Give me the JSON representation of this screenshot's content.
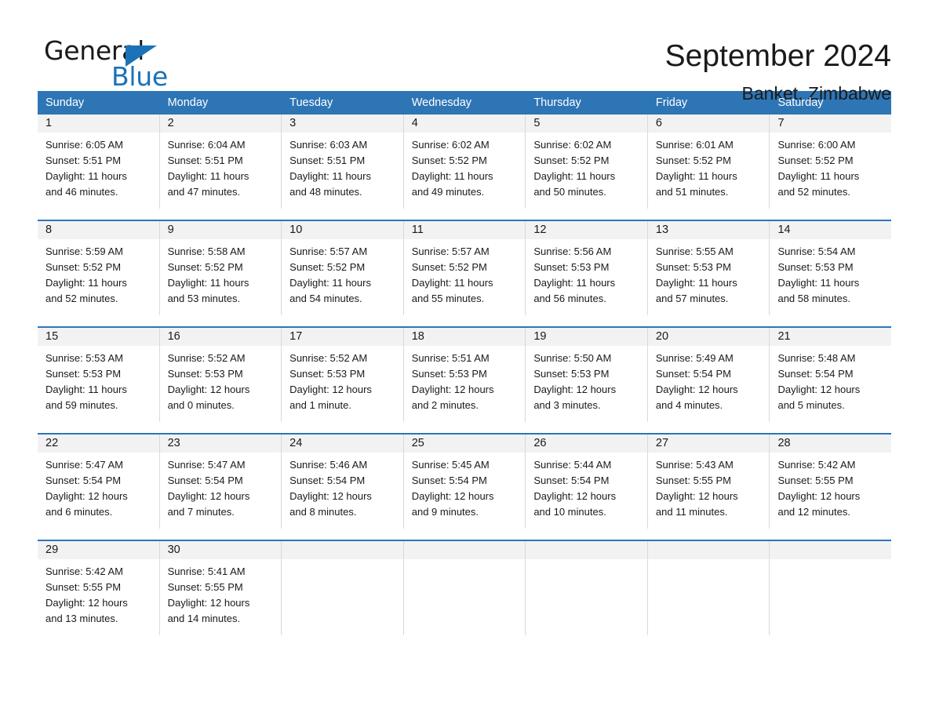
{
  "brand": {
    "word1": "General",
    "word2": "Blue",
    "triangle_color": "#1B72B8"
  },
  "header": {
    "month_title": "September 2024",
    "location": "Banket, Zimbabwe",
    "header_bg": "#2E75B6",
    "daynum_bg": "#F2F2F2"
  },
  "calendar": {
    "weekday_headers": [
      "Sunday",
      "Monday",
      "Tuesday",
      "Wednesday",
      "Thursday",
      "Friday",
      "Saturday"
    ],
    "labels": {
      "sunrise": "Sunrise:",
      "sunset": "Sunset:",
      "daylight": "Daylight:"
    },
    "weeks": [
      [
        {
          "day": "1",
          "sunrise": "Sunrise: 6:05 AM",
          "sunset": "Sunset: 5:51 PM",
          "daylight_line1": "Daylight: 11 hours",
          "daylight_line2": "and 46 minutes."
        },
        {
          "day": "2",
          "sunrise": "Sunrise: 6:04 AM",
          "sunset": "Sunset: 5:51 PM",
          "daylight_line1": "Daylight: 11 hours",
          "daylight_line2": "and 47 minutes."
        },
        {
          "day": "3",
          "sunrise": "Sunrise: 6:03 AM",
          "sunset": "Sunset: 5:51 PM",
          "daylight_line1": "Daylight: 11 hours",
          "daylight_line2": "and 48 minutes."
        },
        {
          "day": "4",
          "sunrise": "Sunrise: 6:02 AM",
          "sunset": "Sunset: 5:52 PM",
          "daylight_line1": "Daylight: 11 hours",
          "daylight_line2": "and 49 minutes."
        },
        {
          "day": "5",
          "sunrise": "Sunrise: 6:02 AM",
          "sunset": "Sunset: 5:52 PM",
          "daylight_line1": "Daylight: 11 hours",
          "daylight_line2": "and 50 minutes."
        },
        {
          "day": "6",
          "sunrise": "Sunrise: 6:01 AM",
          "sunset": "Sunset: 5:52 PM",
          "daylight_line1": "Daylight: 11 hours",
          "daylight_line2": "and 51 minutes."
        },
        {
          "day": "7",
          "sunrise": "Sunrise: 6:00 AM",
          "sunset": "Sunset: 5:52 PM",
          "daylight_line1": "Daylight: 11 hours",
          "daylight_line2": "and 52 minutes."
        }
      ],
      [
        {
          "day": "8",
          "sunrise": "Sunrise: 5:59 AM",
          "sunset": "Sunset: 5:52 PM",
          "daylight_line1": "Daylight: 11 hours",
          "daylight_line2": "and 52 minutes."
        },
        {
          "day": "9",
          "sunrise": "Sunrise: 5:58 AM",
          "sunset": "Sunset: 5:52 PM",
          "daylight_line1": "Daylight: 11 hours",
          "daylight_line2": "and 53 minutes."
        },
        {
          "day": "10",
          "sunrise": "Sunrise: 5:57 AM",
          "sunset": "Sunset: 5:52 PM",
          "daylight_line1": "Daylight: 11 hours",
          "daylight_line2": "and 54 minutes."
        },
        {
          "day": "11",
          "sunrise": "Sunrise: 5:57 AM",
          "sunset": "Sunset: 5:52 PM",
          "daylight_line1": "Daylight: 11 hours",
          "daylight_line2": "and 55 minutes."
        },
        {
          "day": "12",
          "sunrise": "Sunrise: 5:56 AM",
          "sunset": "Sunset: 5:53 PM",
          "daylight_line1": "Daylight: 11 hours",
          "daylight_line2": "and 56 minutes."
        },
        {
          "day": "13",
          "sunrise": "Sunrise: 5:55 AM",
          "sunset": "Sunset: 5:53 PM",
          "daylight_line1": "Daylight: 11 hours",
          "daylight_line2": "and 57 minutes."
        },
        {
          "day": "14",
          "sunrise": "Sunrise: 5:54 AM",
          "sunset": "Sunset: 5:53 PM",
          "daylight_line1": "Daylight: 11 hours",
          "daylight_line2": "and 58 minutes."
        }
      ],
      [
        {
          "day": "15",
          "sunrise": "Sunrise: 5:53 AM",
          "sunset": "Sunset: 5:53 PM",
          "daylight_line1": "Daylight: 11 hours",
          "daylight_line2": "and 59 minutes."
        },
        {
          "day": "16",
          "sunrise": "Sunrise: 5:52 AM",
          "sunset": "Sunset: 5:53 PM",
          "daylight_line1": "Daylight: 12 hours",
          "daylight_line2": "and 0 minutes."
        },
        {
          "day": "17",
          "sunrise": "Sunrise: 5:52 AM",
          "sunset": "Sunset: 5:53 PM",
          "daylight_line1": "Daylight: 12 hours",
          "daylight_line2": "and 1 minute."
        },
        {
          "day": "18",
          "sunrise": "Sunrise: 5:51 AM",
          "sunset": "Sunset: 5:53 PM",
          "daylight_line1": "Daylight: 12 hours",
          "daylight_line2": "and 2 minutes."
        },
        {
          "day": "19",
          "sunrise": "Sunrise: 5:50 AM",
          "sunset": "Sunset: 5:53 PM",
          "daylight_line1": "Daylight: 12 hours",
          "daylight_line2": "and 3 minutes."
        },
        {
          "day": "20",
          "sunrise": "Sunrise: 5:49 AM",
          "sunset": "Sunset: 5:54 PM",
          "daylight_line1": "Daylight: 12 hours",
          "daylight_line2": "and 4 minutes."
        },
        {
          "day": "21",
          "sunrise": "Sunrise: 5:48 AM",
          "sunset": "Sunset: 5:54 PM",
          "daylight_line1": "Daylight: 12 hours",
          "daylight_line2": "and 5 minutes."
        }
      ],
      [
        {
          "day": "22",
          "sunrise": "Sunrise: 5:47 AM",
          "sunset": "Sunset: 5:54 PM",
          "daylight_line1": "Daylight: 12 hours",
          "daylight_line2": "and 6 minutes."
        },
        {
          "day": "23",
          "sunrise": "Sunrise: 5:47 AM",
          "sunset": "Sunset: 5:54 PM",
          "daylight_line1": "Daylight: 12 hours",
          "daylight_line2": "and 7 minutes."
        },
        {
          "day": "24",
          "sunrise": "Sunrise: 5:46 AM",
          "sunset": "Sunset: 5:54 PM",
          "daylight_line1": "Daylight: 12 hours",
          "daylight_line2": "and 8 minutes."
        },
        {
          "day": "25",
          "sunrise": "Sunrise: 5:45 AM",
          "sunset": "Sunset: 5:54 PM",
          "daylight_line1": "Daylight: 12 hours",
          "daylight_line2": "and 9 minutes."
        },
        {
          "day": "26",
          "sunrise": "Sunrise: 5:44 AM",
          "sunset": "Sunset: 5:54 PM",
          "daylight_line1": "Daylight: 12 hours",
          "daylight_line2": "and 10 minutes."
        },
        {
          "day": "27",
          "sunrise": "Sunrise: 5:43 AM",
          "sunset": "Sunset: 5:55 PM",
          "daylight_line1": "Daylight: 12 hours",
          "daylight_line2": "and 11 minutes."
        },
        {
          "day": "28",
          "sunrise": "Sunrise: 5:42 AM",
          "sunset": "Sunset: 5:55 PM",
          "daylight_line1": "Daylight: 12 hours",
          "daylight_line2": "and 12 minutes."
        }
      ],
      [
        {
          "day": "29",
          "sunrise": "Sunrise: 5:42 AM",
          "sunset": "Sunset: 5:55 PM",
          "daylight_line1": "Daylight: 12 hours",
          "daylight_line2": "and 13 minutes."
        },
        {
          "day": "30",
          "sunrise": "Sunrise: 5:41 AM",
          "sunset": "Sunset: 5:55 PM",
          "daylight_line1": "Daylight: 12 hours",
          "daylight_line2": "and 14 minutes."
        },
        {
          "day": "",
          "sunrise": "",
          "sunset": "",
          "daylight_line1": "",
          "daylight_line2": ""
        },
        {
          "day": "",
          "sunrise": "",
          "sunset": "",
          "daylight_line1": "",
          "daylight_line2": ""
        },
        {
          "day": "",
          "sunrise": "",
          "sunset": "",
          "daylight_line1": "",
          "daylight_line2": ""
        },
        {
          "day": "",
          "sunrise": "",
          "sunset": "",
          "daylight_line1": "",
          "daylight_line2": ""
        },
        {
          "day": "",
          "sunrise": "",
          "sunset": "",
          "daylight_line1": "",
          "daylight_line2": ""
        }
      ]
    ]
  }
}
